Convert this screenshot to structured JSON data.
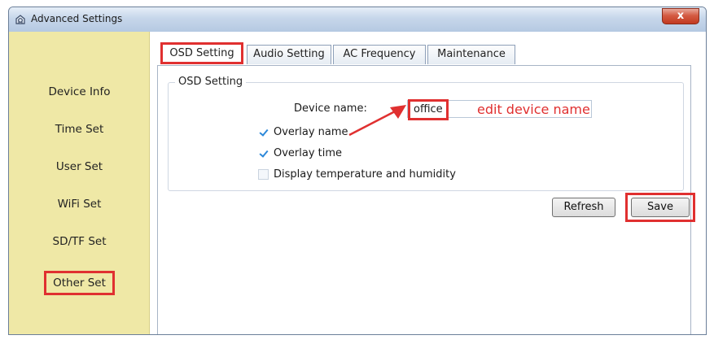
{
  "window": {
    "title": "Advanced Settings",
    "close_label": "x"
  },
  "sidebar": {
    "items": [
      {
        "label": "Device Info"
      },
      {
        "label": "Time Set"
      },
      {
        "label": "User Set"
      },
      {
        "label": "WiFi Set"
      },
      {
        "label": "SD/TF Set"
      },
      {
        "label": "Other Set",
        "selected": true
      }
    ]
  },
  "tabs": [
    {
      "label": "OSD Setting",
      "active": true
    },
    {
      "label": "Audio Setting"
    },
    {
      "label": "AC Frequency"
    },
    {
      "label": "Maintenance"
    }
  ],
  "osd": {
    "group_title": "OSD Setting",
    "device_name_label": "Device name:",
    "device_name_value": "office",
    "annotation": "edit device name",
    "checkboxes": [
      {
        "label": "Overlay name",
        "checked": true
      },
      {
        "label": "Overlay time",
        "checked": true
      },
      {
        "label": "Display temperature and humidity",
        "checked": false
      }
    ]
  },
  "buttons": {
    "refresh": "Refresh",
    "save": "Save"
  },
  "colors": {
    "highlight": "#e03030",
    "sidebar_bg": "#efe8a6",
    "check": "#2c88d9"
  },
  "icons": {
    "app": "app-gear-icon",
    "arrow": "annotation-arrow-icon",
    "check": "checkmark-icon"
  }
}
